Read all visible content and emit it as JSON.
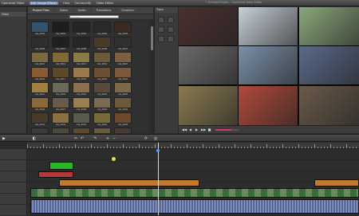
{
  "menu": {
    "items": [
      "Openshot Video",
      "Edit Image Effects",
      "Help",
      "Community",
      "Video Editor"
    ],
    "active_index": 1,
    "window_title": "* Untitled Project - OpenShot Video Editor"
  },
  "left_panel": {
    "items": [
      "",
      "Video"
    ]
  },
  "tabs": [
    "Project Files",
    "Video",
    "Audio",
    "Transitions",
    "Graphics"
  ],
  "filter": {
    "placeholder": "Search"
  },
  "thumbnails": [
    {
      "label": "clip_0001",
      "color": "#35526e"
    },
    {
      "label": "clip_0002",
      "color": "#1d1d1d"
    },
    {
      "label": "clip_0003",
      "color": "#252525"
    },
    {
      "label": "clip_0004",
      "color": "#2a2a2a"
    },
    {
      "label": "clip_0005",
      "color": "#3a2a22"
    },
    {
      "label": "clip_0006",
      "color": "#2e2e2e"
    },
    {
      "label": "clip_0007",
      "color": "#1f1f1f"
    },
    {
      "label": "clip_0008",
      "color": "#262626"
    },
    {
      "label": "clip_0009",
      "color": "#4a3a2a"
    },
    {
      "label": "clip_0010",
      "color": "#303030"
    },
    {
      "label": "clip_0011",
      "color": "#7a6a40"
    },
    {
      "label": "clip_0012",
      "color": "#806a3a"
    },
    {
      "label": "clip_0013",
      "color": "#8a7a4a"
    },
    {
      "label": "clip_0014",
      "color": "#6a5a3a"
    },
    {
      "label": "clip_0015",
      "color": "#7a6040"
    },
    {
      "label": "clip_0016",
      "color": "#8a5a30"
    },
    {
      "label": "clip_0017",
      "color": "#5a4a2a"
    },
    {
      "label": "clip_0018",
      "color": "#9a7a4a"
    },
    {
      "label": "clip_0019",
      "color": "#6a5030"
    },
    {
      "label": "clip_0020",
      "color": "#7a5a3a"
    },
    {
      "label": "clip_0021",
      "color": "#a08040"
    },
    {
      "label": "clip_0022",
      "color": "#6a6a5a"
    },
    {
      "label": "clip_0023",
      "color": "#8a7050"
    },
    {
      "label": "clip_0024",
      "color": "#5a4a3a"
    },
    {
      "label": "clip_0025",
      "color": "#7a6a4a"
    },
    {
      "label": "clip_0026",
      "color": "#8a6a3a"
    },
    {
      "label": "clip_0027",
      "color": "#6a5a4a"
    },
    {
      "label": "clip_0028",
      "color": "#9a8050"
    },
    {
      "label": "clip_0029",
      "color": "#7a6a50"
    },
    {
      "label": "clip_0030",
      "color": "#6a5a3a"
    },
    {
      "label": "clip_0031",
      "color": "#4a3a2a"
    },
    {
      "label": "clip_0032",
      "color": "#8a7040"
    },
    {
      "label": "clip_0033",
      "color": "#5a5a4a"
    },
    {
      "label": "clip_0034",
      "color": "#7a6a3a"
    },
    {
      "label": "clip_0035",
      "color": "#6a4a2a"
    },
    {
      "label": "clip_0036",
      "color": "#3a3a3a"
    },
    {
      "label": "clip_0037",
      "color": "#4a4a3a"
    },
    {
      "label": "clip_0038",
      "color": "#5a4a30"
    },
    {
      "label": "clip_0039",
      "color": "#6a5a40"
    },
    {
      "label": "clip_0040",
      "color": "#4a3a30"
    }
  ],
  "toolcol": {
    "header": "Trans"
  },
  "preview_tiles": [
    {
      "color": "#4a3030"
    },
    {
      "color": "#c8d0d8"
    },
    {
      "color": "#8aa87a"
    },
    {
      "color": "#6a6a6a"
    },
    {
      "color": "#7a90a8"
    },
    {
      "color": "#5a6a8a"
    },
    {
      "color": "#8a7a50"
    },
    {
      "color": "#b04a3a"
    },
    {
      "color": "#6a5a4a"
    }
  ],
  "preview_controls": [
    "◀◀",
    "◀",
    "▶",
    "▶▶",
    "■"
  ],
  "timeline_toolbar": [
    "▶",
    "◧",
    "✂",
    "↶",
    "↷",
    "+",
    "−",
    "⟳",
    "◎"
  ],
  "ruler_labels": [],
  "track_colors": {
    "green": "#28b428",
    "red": "#b43a3a",
    "orange": "#c07a30",
    "video": "#3a6a3a",
    "audio": "#3a4a7a"
  }
}
